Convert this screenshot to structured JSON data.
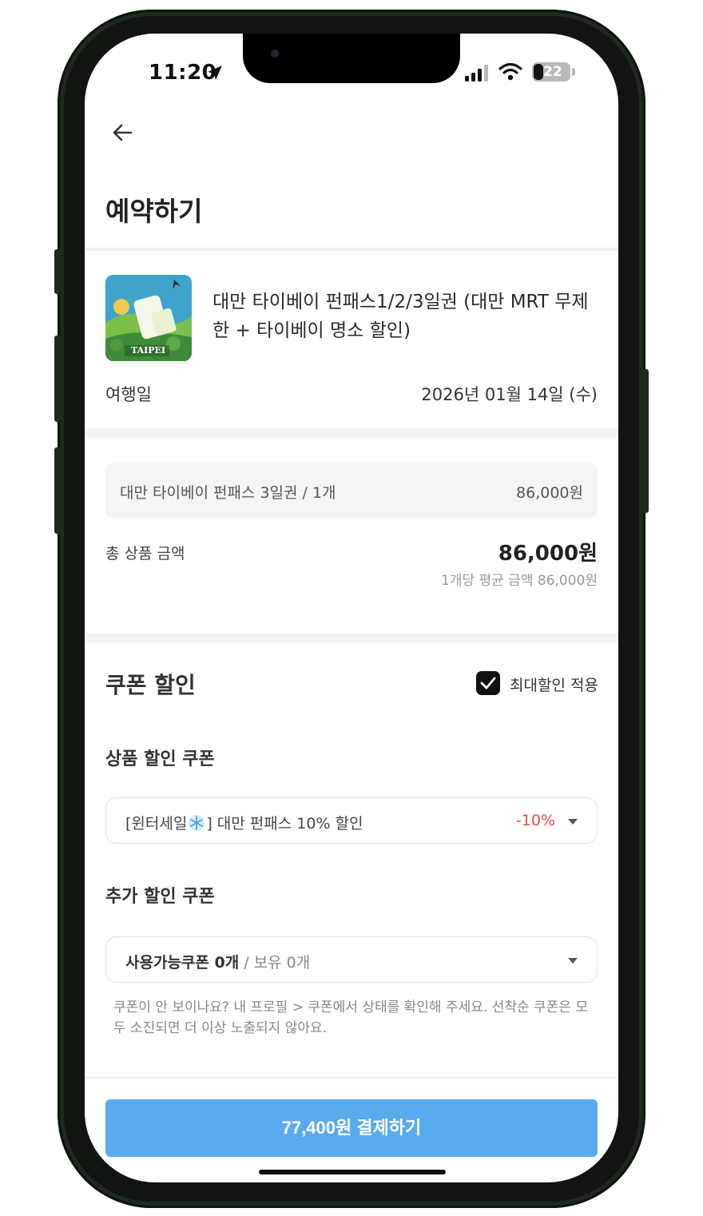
{
  "status_bar": {
    "time": "11:20",
    "battery": "22",
    "icons": [
      "location-arrow-icon",
      "signal-icon",
      "wifi-icon",
      "battery-icon"
    ]
  },
  "header": {
    "back_icon": "arrow-left-icon",
    "title": "예약하기"
  },
  "product": {
    "thumbnail_label": "TAIPEI",
    "name": "대만 타이베이 펀패스1/2/3일권 (대만 MRT 무제한 + 타이베이 명소 할인)",
    "travel_date_label": "여행일",
    "travel_date_value": "2026년 01월 14일 (수)"
  },
  "order": {
    "line_item_name": "대만 타이베이 펀패스 3일권 / 1개",
    "line_item_price": "86,000원",
    "total_label": "총 상품 금액",
    "total_price": "86,000원",
    "avg_price": "1개당 평균 금액 86,000원"
  },
  "coupon": {
    "title": "쿠폰 할인",
    "max_discount_label": "최대할인 적용",
    "max_discount_checked": true,
    "product_coupon_title": "상품 할인 쿠폰",
    "product_coupon_prefix": "[윈터세일",
    "product_coupon_suffix": "] 대만 펀패스 10% 할인",
    "product_coupon_discount": "-10%",
    "extra_coupon_title": "추가 할인 쿠폰",
    "extra_coupon_available": "사용가능쿠폰 0개",
    "extra_coupon_owned": " / 보유 0개",
    "notice": "쿠폰이 안 보이나요? 내 프로필 > 쿠폰에서 상태를 확인해 주세요. 선착순 쿠폰은 모두 소진되면 더 이상 노출되지 않아요."
  },
  "footer": {
    "pay_button": "77,400원 결제하기"
  },
  "colors": {
    "accent_blue": "#5aaaf0",
    "discount_red": "#f04848",
    "frame_green": "#1f2a1e"
  }
}
